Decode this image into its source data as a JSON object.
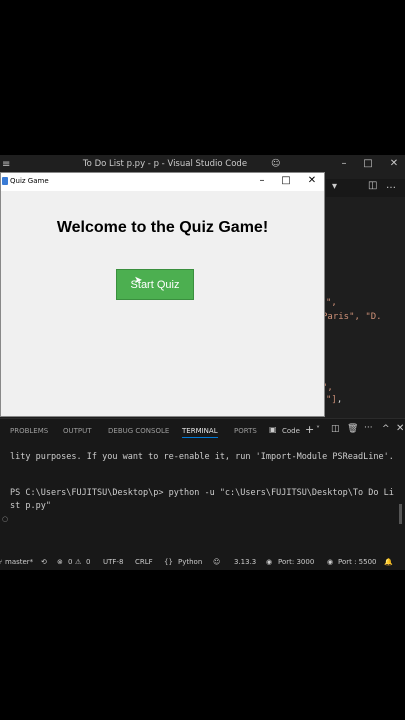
{
  "vscode": {
    "title": "To Do List p.py - p - Visual Studio Code",
    "code_lines": [
      {
        "text": "\",",
        "tail": ""
      },
      {
        "text": "Paris\", \"D.",
        "tail": ""
      },
      {
        "text": "\",",
        "tail": ""
      },
      {
        "text": "\"]",
        "tail": ","
      }
    ],
    "panel_tabs": [
      "PROBLEMS",
      "OUTPUT",
      "DEBUG CONSOLE",
      "TERMINAL",
      "PORTS"
    ],
    "terminal_label": "Code",
    "terminal_lines": [
      "lity purposes. If you want to re-enable it, run 'Import-Module PSReadLine'.",
      "",
      "PS C:\\Users\\FUJITSU\\Desktop\\p> python -u \"c:\\Users\\FUJITSU\\Desktop\\To Do Li",
      "st p.py\""
    ],
    "status": {
      "branch": "master*",
      "errors": "0",
      "warnings": "0",
      "encoding": "UTF-8",
      "eol": "CRLF",
      "language": "Python",
      "version": "3.13.3",
      "port1": "Port: 3000",
      "port2": "Port : 5500"
    }
  },
  "quiz_window": {
    "title": "Quiz Game",
    "heading": "Welcome to the Quiz Game!",
    "start_button": "Start Quiz",
    "accent": "#4caf50"
  }
}
